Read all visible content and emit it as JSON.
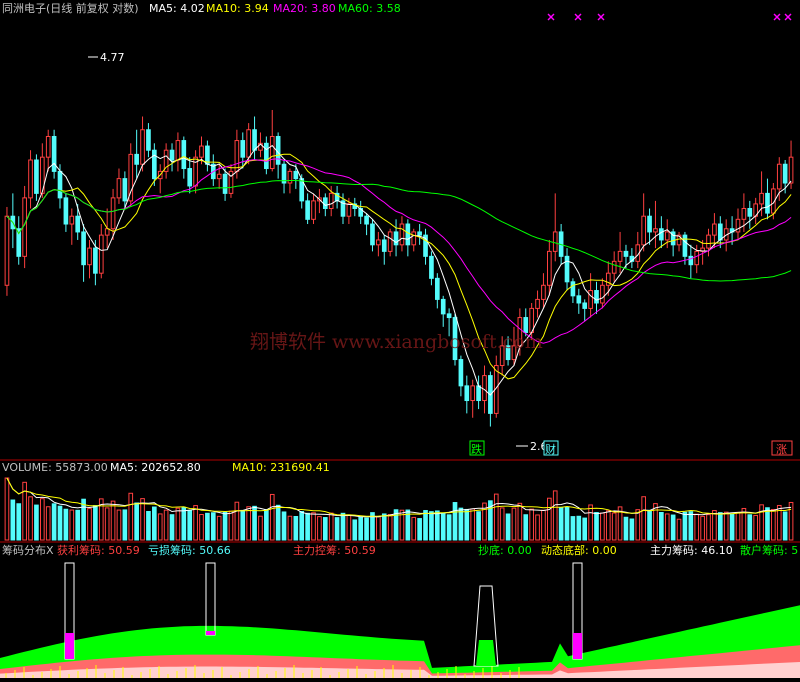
{
  "header": {
    "title": "同洲电子(日线 前复权 对数)",
    "ma5": "MA5: 4.02",
    "ma10": "MA10: 3.94",
    "ma20": "MA20: 3.80",
    "ma60": "MA60: 3.58"
  },
  "colors": {
    "up": "#ff4040",
    "down": "#54fcfc",
    "ma5": "#ffffff",
    "ma10": "#ffff00",
    "ma20": "#ff00ff",
    "ma60": "#00ff00",
    "separator": "#b00000",
    "axis_text": "#c0c0c0"
  },
  "watermark": "翔博软件 www.xiangbosoft.com",
  "annotations": {
    "high_label": "4.77",
    "low_label": "2.66",
    "tag_die": "跌",
    "tag_cai": "财",
    "tag_zhang": "涨"
  },
  "volume_panel": {
    "label": "VOLUME: 55873.00",
    "ma5": "MA5: 202652.80",
    "ma10": "MA10: 231690.41"
  },
  "chip_panel": {
    "name": "筹码分布X",
    "profit": "获利筹码: 50.59",
    "loss": "亏损筹码: 50.66",
    "control": "主力控筹: 50.59",
    "bottom": "抄底: 0.00",
    "dynamic_bottom": "动态底部: 0.00",
    "main_chips": "主力筹码: 46.10",
    "retail_chips": "散户筹码: 5"
  },
  "chart_data": {
    "type": "candlestick",
    "scale": "log",
    "ylim": [
      2.6,
      5.3
    ],
    "high": 4.77,
    "low": 2.66,
    "last": {
      "ma5": 4.02,
      "ma10": 3.94,
      "ma20": 3.8,
      "ma60": 3.58
    },
    "candles": [
      [
        3.38,
        3.8,
        3.32,
        3.86
      ],
      [
        3.8,
        3.72,
        3.6,
        3.95
      ],
      [
        3.72,
        3.55,
        3.5,
        3.8
      ],
      [
        3.55,
        3.92,
        3.48,
        4.0
      ],
      [
        3.92,
        4.18,
        3.85,
        4.25
      ],
      [
        4.18,
        3.95,
        3.9,
        4.22
      ],
      [
        3.95,
        4.2,
        3.92,
        4.3
      ],
      [
        4.2,
        4.35,
        4.1,
        4.4
      ],
      [
        4.35,
        4.1,
        4.05,
        4.4
      ],
      [
        4.1,
        3.92,
        3.85,
        4.15
      ],
      [
        3.92,
        3.75,
        3.7,
        3.95
      ],
      [
        3.75,
        3.8,
        3.62,
        3.85
      ],
      [
        3.8,
        3.7,
        3.65,
        3.88
      ],
      [
        3.7,
        3.5,
        3.4,
        3.75
      ],
      [
        3.5,
        3.6,
        3.42,
        3.65
      ],
      [
        3.6,
        3.45,
        3.38,
        3.65
      ],
      [
        3.45,
        3.68,
        3.42,
        3.75
      ],
      [
        3.68,
        3.72,
        3.6,
        3.85
      ],
      [
        3.72,
        3.92,
        3.65,
        3.98
      ],
      [
        3.92,
        4.05,
        3.88,
        4.12
      ],
      [
        4.05,
        3.9,
        3.85,
        4.1
      ],
      [
        3.9,
        4.22,
        3.86,
        4.3
      ],
      [
        4.22,
        4.15,
        4.05,
        4.4
      ],
      [
        4.15,
        4.4,
        4.1,
        4.5
      ],
      [
        4.4,
        4.25,
        4.2,
        4.45
      ],
      [
        4.25,
        4.05,
        4.0,
        4.3
      ],
      [
        4.05,
        4.1,
        3.95,
        4.15
      ],
      [
        4.1,
        4.25,
        4.05,
        4.3
      ],
      [
        4.25,
        4.18,
        4.1,
        4.3
      ],
      [
        4.18,
        4.32,
        4.1,
        4.38
      ],
      [
        4.32,
        4.12,
        4.05,
        4.35
      ],
      [
        4.12,
        4.0,
        3.95,
        4.2
      ],
      [
        4.0,
        4.2,
        3.95,
        4.25
      ],
      [
        4.2,
        4.28,
        4.15,
        4.35
      ],
      [
        4.28,
        4.15,
        4.1,
        4.32
      ],
      [
        4.15,
        4.05,
        4.0,
        4.22
      ],
      [
        4.05,
        4.08,
        3.98,
        4.15
      ],
      [
        4.08,
        3.95,
        3.9,
        4.12
      ],
      [
        3.95,
        4.1,
        3.92,
        4.15
      ],
      [
        4.1,
        4.32,
        4.05,
        4.4
      ],
      [
        4.32,
        4.2,
        4.12,
        4.38
      ],
      [
        4.2,
        4.4,
        4.15,
        4.45
      ],
      [
        4.4,
        4.25,
        4.18,
        4.5
      ],
      [
        4.25,
        4.3,
        4.2,
        4.38
      ],
      [
        4.3,
        4.12,
        4.08,
        4.35
      ],
      [
        4.12,
        4.35,
        4.1,
        4.55
      ],
      [
        4.35,
        4.15,
        4.05,
        4.38
      ],
      [
        4.15,
        4.02,
        3.95,
        4.18
      ],
      [
        4.02,
        4.1,
        3.95,
        4.12
      ],
      [
        4.1,
        4.05,
        3.98,
        4.15
      ],
      [
        4.05,
        3.9,
        3.85,
        4.08
      ],
      [
        3.9,
        3.78,
        3.75,
        3.95
      ],
      [
        3.78,
        3.9,
        3.75,
        3.95
      ],
      [
        3.9,
        3.92,
        3.82,
        3.98
      ],
      [
        3.92,
        3.85,
        3.8,
        3.95
      ],
      [
        3.85,
        3.95,
        3.8,
        4.0
      ],
      [
        3.95,
        3.9,
        3.85,
        4.0
      ],
      [
        3.9,
        3.8,
        3.75,
        3.95
      ],
      [
        3.8,
        3.88,
        3.75,
        3.92
      ],
      [
        3.88,
        3.85,
        3.8,
        3.92
      ],
      [
        3.85,
        3.8,
        3.75,
        3.9
      ],
      [
        3.8,
        3.75,
        3.68,
        3.82
      ],
      [
        3.75,
        3.62,
        3.58,
        3.78
      ],
      [
        3.62,
        3.65,
        3.55,
        3.7
      ],
      [
        3.65,
        3.58,
        3.5,
        3.68
      ],
      [
        3.58,
        3.7,
        3.55,
        3.72
      ],
      [
        3.7,
        3.62,
        3.55,
        3.78
      ],
      [
        3.62,
        3.75,
        3.58,
        3.8
      ],
      [
        3.75,
        3.62,
        3.55,
        3.78
      ],
      [
        3.62,
        3.7,
        3.58,
        3.72
      ],
      [
        3.7,
        3.68,
        3.62,
        3.75
      ],
      [
        3.68,
        3.55,
        3.5,
        3.72
      ],
      [
        3.55,
        3.42,
        3.38,
        3.58
      ],
      [
        3.42,
        3.3,
        3.25,
        3.45
      ],
      [
        3.3,
        3.22,
        3.15,
        3.32
      ],
      [
        3.22,
        3.2,
        3.1,
        3.25
      ],
      [
        3.2,
        2.98,
        2.95,
        3.22
      ],
      [
        2.98,
        2.85,
        2.8,
        3.0
      ],
      [
        2.85,
        2.78,
        2.72,
        2.9
      ],
      [
        2.78,
        2.85,
        2.7,
        2.88
      ],
      [
        2.85,
        2.78,
        2.74,
        2.9
      ],
      [
        2.78,
        2.9,
        2.72,
        2.95
      ],
      [
        2.9,
        2.72,
        2.66,
        2.92
      ],
      [
        2.72,
        2.95,
        2.7,
        3.0
      ],
      [
        2.95,
        3.05,
        2.9,
        3.1
      ],
      [
        3.05,
        2.98,
        2.95,
        3.1
      ],
      [
        2.98,
        3.05,
        2.95,
        3.15
      ],
      [
        3.05,
        3.2,
        3.0,
        3.25
      ],
      [
        3.2,
        3.12,
        3.1,
        3.25
      ],
      [
        3.12,
        3.25,
        3.08,
        3.28
      ],
      [
        3.25,
        3.3,
        3.2,
        3.35
      ],
      [
        3.3,
        3.38,
        3.25,
        3.45
      ],
      [
        3.38,
        3.58,
        3.32,
        3.65
      ],
      [
        3.58,
        3.7,
        3.52,
        3.95
      ],
      [
        3.7,
        3.55,
        3.5,
        3.75
      ],
      [
        3.55,
        3.4,
        3.35,
        3.6
      ],
      [
        3.4,
        3.32,
        3.28,
        3.42
      ],
      [
        3.32,
        3.28,
        3.22,
        3.36
      ],
      [
        3.28,
        3.25,
        3.18,
        3.3
      ],
      [
        3.25,
        3.35,
        3.2,
        3.45
      ],
      [
        3.35,
        3.28,
        3.22,
        3.4
      ],
      [
        3.28,
        3.38,
        3.25,
        3.42
      ],
      [
        3.38,
        3.45,
        3.32,
        3.52
      ],
      [
        3.45,
        3.52,
        3.4,
        3.58
      ],
      [
        3.52,
        3.58,
        3.45,
        3.7
      ],
      [
        3.58,
        3.55,
        3.48,
        3.62
      ],
      [
        3.55,
        3.52,
        3.48,
        3.6
      ],
      [
        3.52,
        3.62,
        3.48,
        3.7
      ],
      [
        3.62,
        3.8,
        3.58,
        3.95
      ],
      [
        3.8,
        3.7,
        3.62,
        3.85
      ],
      [
        3.7,
        3.72,
        3.6,
        3.9
      ],
      [
        3.72,
        3.65,
        3.6,
        3.8
      ],
      [
        3.65,
        3.7,
        3.6,
        3.78
      ],
      [
        3.7,
        3.62,
        3.55,
        3.72
      ],
      [
        3.62,
        3.68,
        3.58,
        3.7
      ],
      [
        3.68,
        3.55,
        3.5,
        3.7
      ],
      [
        3.55,
        3.5,
        3.42,
        3.62
      ],
      [
        3.5,
        3.58,
        3.45,
        3.62
      ],
      [
        3.58,
        3.6,
        3.5,
        3.65
      ],
      [
        3.6,
        3.68,
        3.55,
        3.72
      ],
      [
        3.68,
        3.75,
        3.6,
        3.82
      ],
      [
        3.75,
        3.65,
        3.6,
        3.8
      ],
      [
        3.65,
        3.72,
        3.58,
        3.78
      ],
      [
        3.72,
        3.7,
        3.62,
        3.8
      ],
      [
        3.7,
        3.78,
        3.65,
        3.85
      ],
      [
        3.78,
        3.85,
        3.7,
        3.95
      ],
      [
        3.85,
        3.8,
        3.72,
        3.9
      ],
      [
        3.8,
        3.88,
        3.75,
        3.92
      ],
      [
        3.88,
        3.95,
        3.8,
        4.1
      ],
      [
        3.95,
        3.82,
        3.78,
        4.05
      ],
      [
        3.82,
        3.98,
        3.78,
        4.02
      ],
      [
        3.98,
        4.15,
        3.9,
        4.2
      ],
      [
        4.15,
        4.02,
        3.95,
        4.18
      ],
      [
        4.02,
        4.2,
        3.98,
        4.32
      ]
    ]
  }
}
